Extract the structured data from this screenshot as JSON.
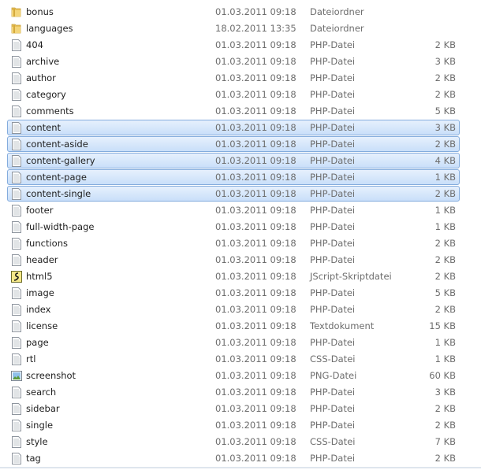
{
  "files": [
    {
      "name": "bonus",
      "date": "01.03.2011 09:18",
      "type": "Dateiordner",
      "size": "",
      "icon": "folder-icon"
    },
    {
      "name": "languages",
      "date": "18.02.2011 13:35",
      "type": "Dateiordner",
      "size": "",
      "icon": "folder-icon"
    },
    {
      "name": "404",
      "date": "01.03.2011 09:18",
      "type": "PHP-Datei",
      "size": "2 KB",
      "icon": "file-icon"
    },
    {
      "name": "archive",
      "date": "01.03.2011 09:18",
      "type": "PHP-Datei",
      "size": "3 KB",
      "icon": "file-icon"
    },
    {
      "name": "author",
      "date": "01.03.2011 09:18",
      "type": "PHP-Datei",
      "size": "2 KB",
      "icon": "file-icon"
    },
    {
      "name": "category",
      "date": "01.03.2011 09:18",
      "type": "PHP-Datei",
      "size": "2 KB",
      "icon": "file-icon"
    },
    {
      "name": "comments",
      "date": "01.03.2011 09:18",
      "type": "PHP-Datei",
      "size": "5 KB",
      "icon": "file-icon"
    },
    {
      "name": "content",
      "date": "01.03.2011 09:18",
      "type": "PHP-Datei",
      "size": "3 KB",
      "icon": "file-icon",
      "selected": true
    },
    {
      "name": "content-aside",
      "date": "01.03.2011 09:18",
      "type": "PHP-Datei",
      "size": "2 KB",
      "icon": "file-icon",
      "selected": true
    },
    {
      "name": "content-gallery",
      "date": "01.03.2011 09:18",
      "type": "PHP-Datei",
      "size": "4 KB",
      "icon": "file-icon",
      "selected": true
    },
    {
      "name": "content-page",
      "date": "01.03.2011 09:18",
      "type": "PHP-Datei",
      "size": "1 KB",
      "icon": "file-icon",
      "selected": true
    },
    {
      "name": "content-single",
      "date": "01.03.2011 09:18",
      "type": "PHP-Datei",
      "size": "2 KB",
      "icon": "file-icon",
      "selected": true
    },
    {
      "name": "footer",
      "date": "01.03.2011 09:18",
      "type": "PHP-Datei",
      "size": "1 KB",
      "icon": "file-icon"
    },
    {
      "name": "full-width-page",
      "date": "01.03.2011 09:18",
      "type": "PHP-Datei",
      "size": "1 KB",
      "icon": "file-icon"
    },
    {
      "name": "functions",
      "date": "01.03.2011 09:18",
      "type": "PHP-Datei",
      "size": "2 KB",
      "icon": "file-icon"
    },
    {
      "name": "header",
      "date": "01.03.2011 09:18",
      "type": "PHP-Datei",
      "size": "2 KB",
      "icon": "file-icon"
    },
    {
      "name": "html5",
      "date": "01.03.2011 09:18",
      "type": "JScript-Skriptdatei",
      "size": "2 KB",
      "icon": "script-icon"
    },
    {
      "name": "image",
      "date": "01.03.2011 09:18",
      "type": "PHP-Datei",
      "size": "5 KB",
      "icon": "file-icon"
    },
    {
      "name": "index",
      "date": "01.03.2011 09:18",
      "type": "PHP-Datei",
      "size": "2 KB",
      "icon": "file-icon"
    },
    {
      "name": "license",
      "date": "01.03.2011 09:18",
      "type": "Textdokument",
      "size": "15 KB",
      "icon": "file-icon"
    },
    {
      "name": "page",
      "date": "01.03.2011 09:18",
      "type": "PHP-Datei",
      "size": "1 KB",
      "icon": "file-icon"
    },
    {
      "name": "rtl",
      "date": "01.03.2011 09:18",
      "type": "CSS-Datei",
      "size": "1 KB",
      "icon": "file-icon"
    },
    {
      "name": "screenshot",
      "date": "01.03.2011 09:18",
      "type": "PNG-Datei",
      "size": "60 KB",
      "icon": "image-icon"
    },
    {
      "name": "search",
      "date": "01.03.2011 09:18",
      "type": "PHP-Datei",
      "size": "3 KB",
      "icon": "file-icon"
    },
    {
      "name": "sidebar",
      "date": "01.03.2011 09:18",
      "type": "PHP-Datei",
      "size": "2 KB",
      "icon": "file-icon"
    },
    {
      "name": "single",
      "date": "01.03.2011 09:18",
      "type": "PHP-Datei",
      "size": "2 KB",
      "icon": "file-icon"
    },
    {
      "name": "style",
      "date": "01.03.2011 09:18",
      "type": "CSS-Datei",
      "size": "7 KB",
      "icon": "file-icon"
    },
    {
      "name": "tag",
      "date": "01.03.2011 09:18",
      "type": "PHP-Datei",
      "size": "2 KB",
      "icon": "file-icon"
    }
  ]
}
